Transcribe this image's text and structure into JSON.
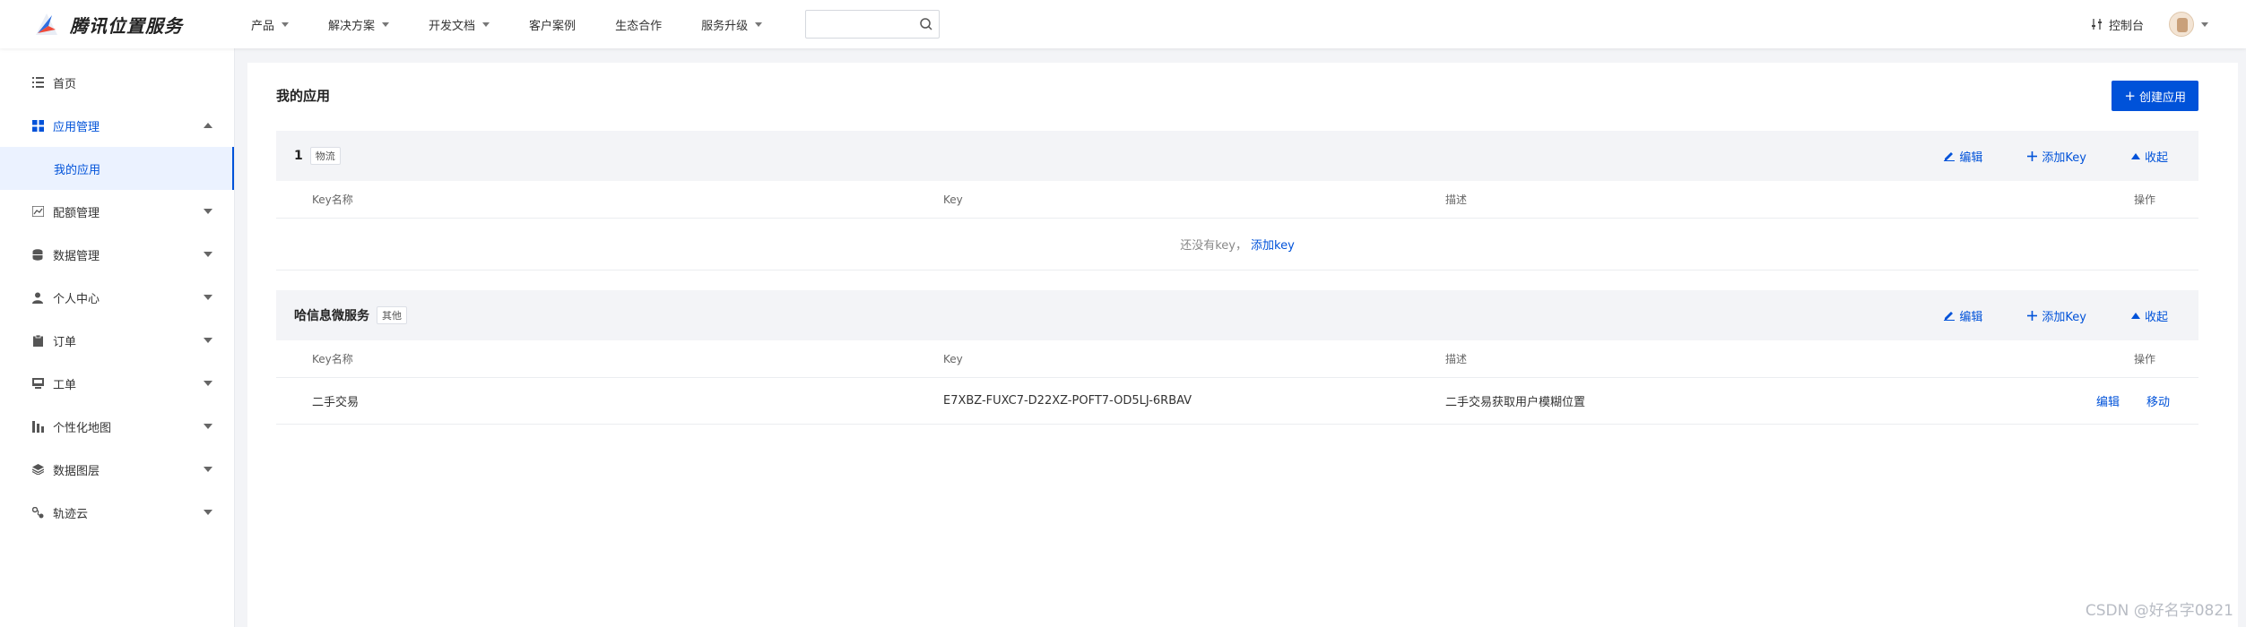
{
  "brand": {
    "name": "腾讯位置服务",
    "accent": "#0052d9"
  },
  "nav": {
    "items": [
      {
        "label": "产品",
        "has_dropdown": true
      },
      {
        "label": "解决方案",
        "has_dropdown": true
      },
      {
        "label": "开发文档",
        "has_dropdown": true
      },
      {
        "label": "客户案例",
        "has_dropdown": false
      },
      {
        "label": "生态合作",
        "has_dropdown": false
      },
      {
        "label": "服务升级",
        "has_dropdown": true
      }
    ],
    "search_icon": "search-icon",
    "console_label": "控制台"
  },
  "sidebar": {
    "items": [
      {
        "label": "首页",
        "icon": "list-icon"
      },
      {
        "label": "应用管理",
        "icon": "grid-icon",
        "expanded": true
      },
      {
        "label": "配额管理",
        "icon": "chart-icon"
      },
      {
        "label": "数据管理",
        "icon": "database-icon"
      },
      {
        "label": "个人中心",
        "icon": "user-icon"
      },
      {
        "label": "订单",
        "icon": "clipboard-icon"
      },
      {
        "label": "工单",
        "icon": "ticket-icon"
      },
      {
        "label": "个性化地图",
        "icon": "map-icon"
      },
      {
        "label": "数据图层",
        "icon": "layers-icon"
      },
      {
        "label": "轨迹云",
        "icon": "track-icon"
      }
    ],
    "sub_item": "我的应用"
  },
  "main": {
    "title": "我的应用",
    "create_label": "创建应用",
    "columns": [
      "Key名称",
      "Key",
      "描述",
      "操作"
    ],
    "apps": [
      {
        "name": "1",
        "tag": "物流",
        "actions": {
          "edit": "编辑",
          "add_key": "添加Key",
          "collapse": "收起"
        },
        "empty_text": "还没有key，",
        "empty_link": "添加key",
        "rows": []
      },
      {
        "name": "哈信息微服务",
        "tag": "其他",
        "actions": {
          "edit": "编辑",
          "add_key": "添加Key",
          "collapse": "收起"
        },
        "rows": [
          {
            "key_name": "二手交易",
            "key": "E7XBZ-FUXC7-D22XZ-POFT7-OD5LJ-6RBAV",
            "description": "二手交易获取用户模糊位置",
            "op_edit": "编辑",
            "op_move": "移动"
          }
        ]
      }
    ]
  },
  "watermark": "CSDN @好名字0821"
}
